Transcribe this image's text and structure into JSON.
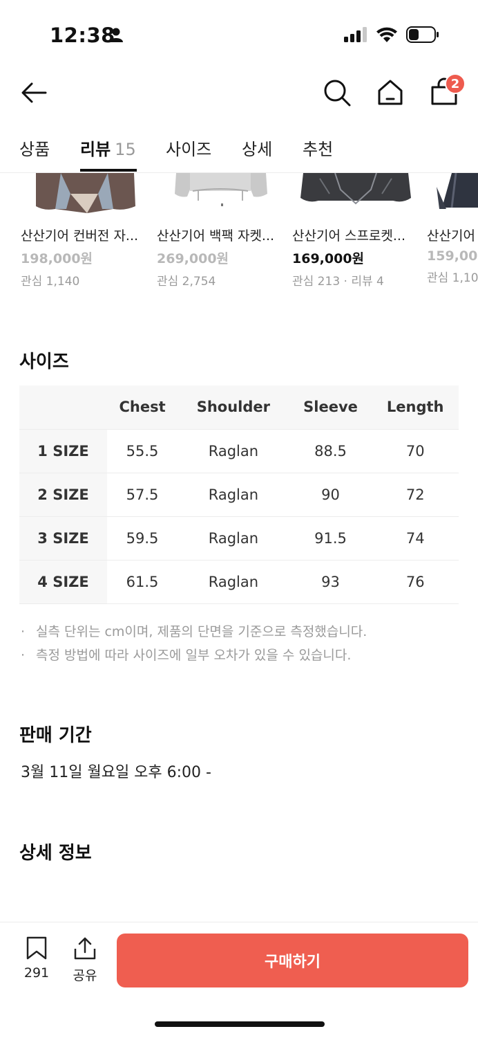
{
  "status": {
    "time": "12:38"
  },
  "nav": {
    "cart_count": "2"
  },
  "tabs": [
    {
      "label": "상품"
    },
    {
      "label": "리뷰",
      "count": "15"
    },
    {
      "label": "사이즈"
    },
    {
      "label": "상세"
    },
    {
      "label": "추천"
    }
  ],
  "products": [
    {
      "name": "산산기어 컨버전 자...",
      "price": "198,000원",
      "meta": "관심 1,140"
    },
    {
      "name": "산산기어 백팩 자켓...",
      "price": "269,000원",
      "meta": "관심 2,754"
    },
    {
      "name": "산산기어 스프로켓...",
      "price": "169,000원",
      "meta": "관심 213 · 리뷰 4"
    },
    {
      "name": "산산기어",
      "price": "159,000",
      "meta": "관심 1,10"
    }
  ],
  "size_section": {
    "title": "사이즈",
    "headers": [
      "Chest",
      "Shoulder",
      "Sleeve",
      "Length"
    ],
    "rows": [
      {
        "size": "1 SIZE",
        "values": [
          "55.5",
          "Raglan",
          "88.5",
          "70"
        ]
      },
      {
        "size": "2 SIZE",
        "values": [
          "57.5",
          "Raglan",
          "90",
          "72"
        ]
      },
      {
        "size": "3 SIZE",
        "values": [
          "59.5",
          "Raglan",
          "91.5",
          "74"
        ]
      },
      {
        "size": "4 SIZE",
        "values": [
          "61.5",
          "Raglan",
          "93",
          "76"
        ]
      }
    ],
    "notes": [
      "실측 단위는 cm이며, 제품의 단면을 기준으로 측정했습니다.",
      "측정 방법에 따라 사이즈에 일부 오차가 있을 수 있습니다."
    ]
  },
  "sale_period": {
    "title": "판매 기간",
    "value": "3월 11일 월요일 오후 6:00 -"
  },
  "detail_info": {
    "title": "상세 정보"
  },
  "bottom_bar": {
    "bookmark_count": "291",
    "share_label": "공유",
    "buy_label": "구매하기"
  },
  "colors": {
    "accent": "#ef5e50",
    "badge": "#ee5b4e"
  }
}
